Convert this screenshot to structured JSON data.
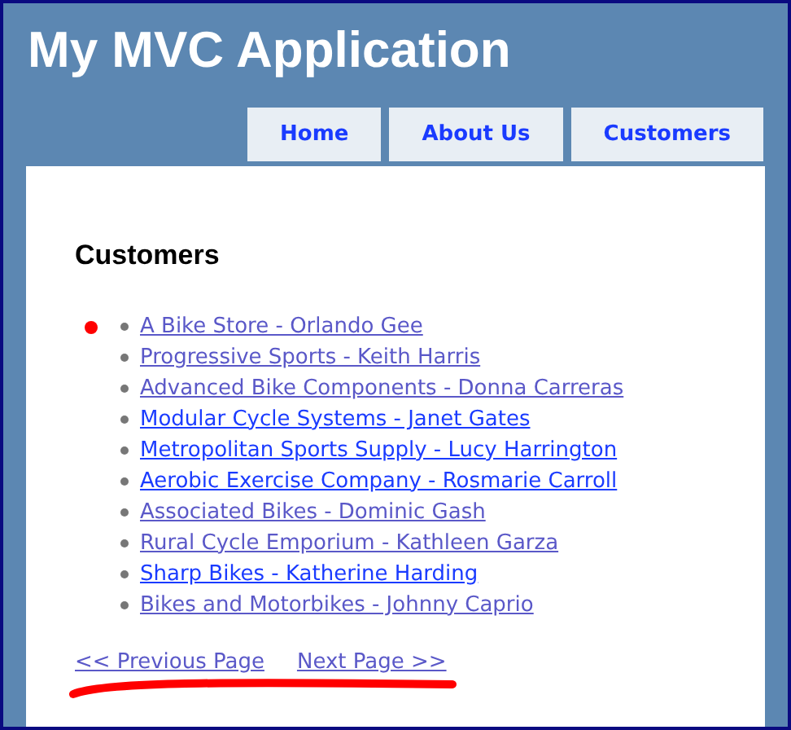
{
  "header": {
    "title": "My MVC Application"
  },
  "tabs": [
    {
      "label": "Home"
    },
    {
      "label": "About Us"
    },
    {
      "label": "Customers"
    }
  ],
  "page": {
    "heading": "Customers",
    "customers": [
      {
        "label": "A Bike Store - Orlando Gee",
        "visited": true,
        "marked": true
      },
      {
        "label": "Progressive Sports - Keith Harris",
        "visited": true,
        "marked": false
      },
      {
        "label": "Advanced Bike Components - Donna Carreras",
        "visited": true,
        "marked": false
      },
      {
        "label": "Modular Cycle Systems - Janet Gates",
        "visited": false,
        "marked": false
      },
      {
        "label": "Metropolitan Sports Supply - Lucy Harrington",
        "visited": false,
        "marked": false
      },
      {
        "label": "Aerobic Exercise Company - Rosmarie Carroll",
        "visited": false,
        "marked": false
      },
      {
        "label": "Associated Bikes - Dominic Gash",
        "visited": true,
        "marked": false
      },
      {
        "label": "Rural Cycle Emporium - Kathleen Garza",
        "visited": true,
        "marked": false
      },
      {
        "label": "Sharp Bikes - Katherine Harding",
        "visited": false,
        "marked": false
      },
      {
        "label": "Bikes and Motorbikes - Johnny Caprio",
        "visited": true,
        "marked": false
      }
    ],
    "pager": [
      {
        "label": "<< Previous Page",
        "visited": true
      },
      {
        "label": "Next Page >>",
        "visited": true
      }
    ]
  }
}
